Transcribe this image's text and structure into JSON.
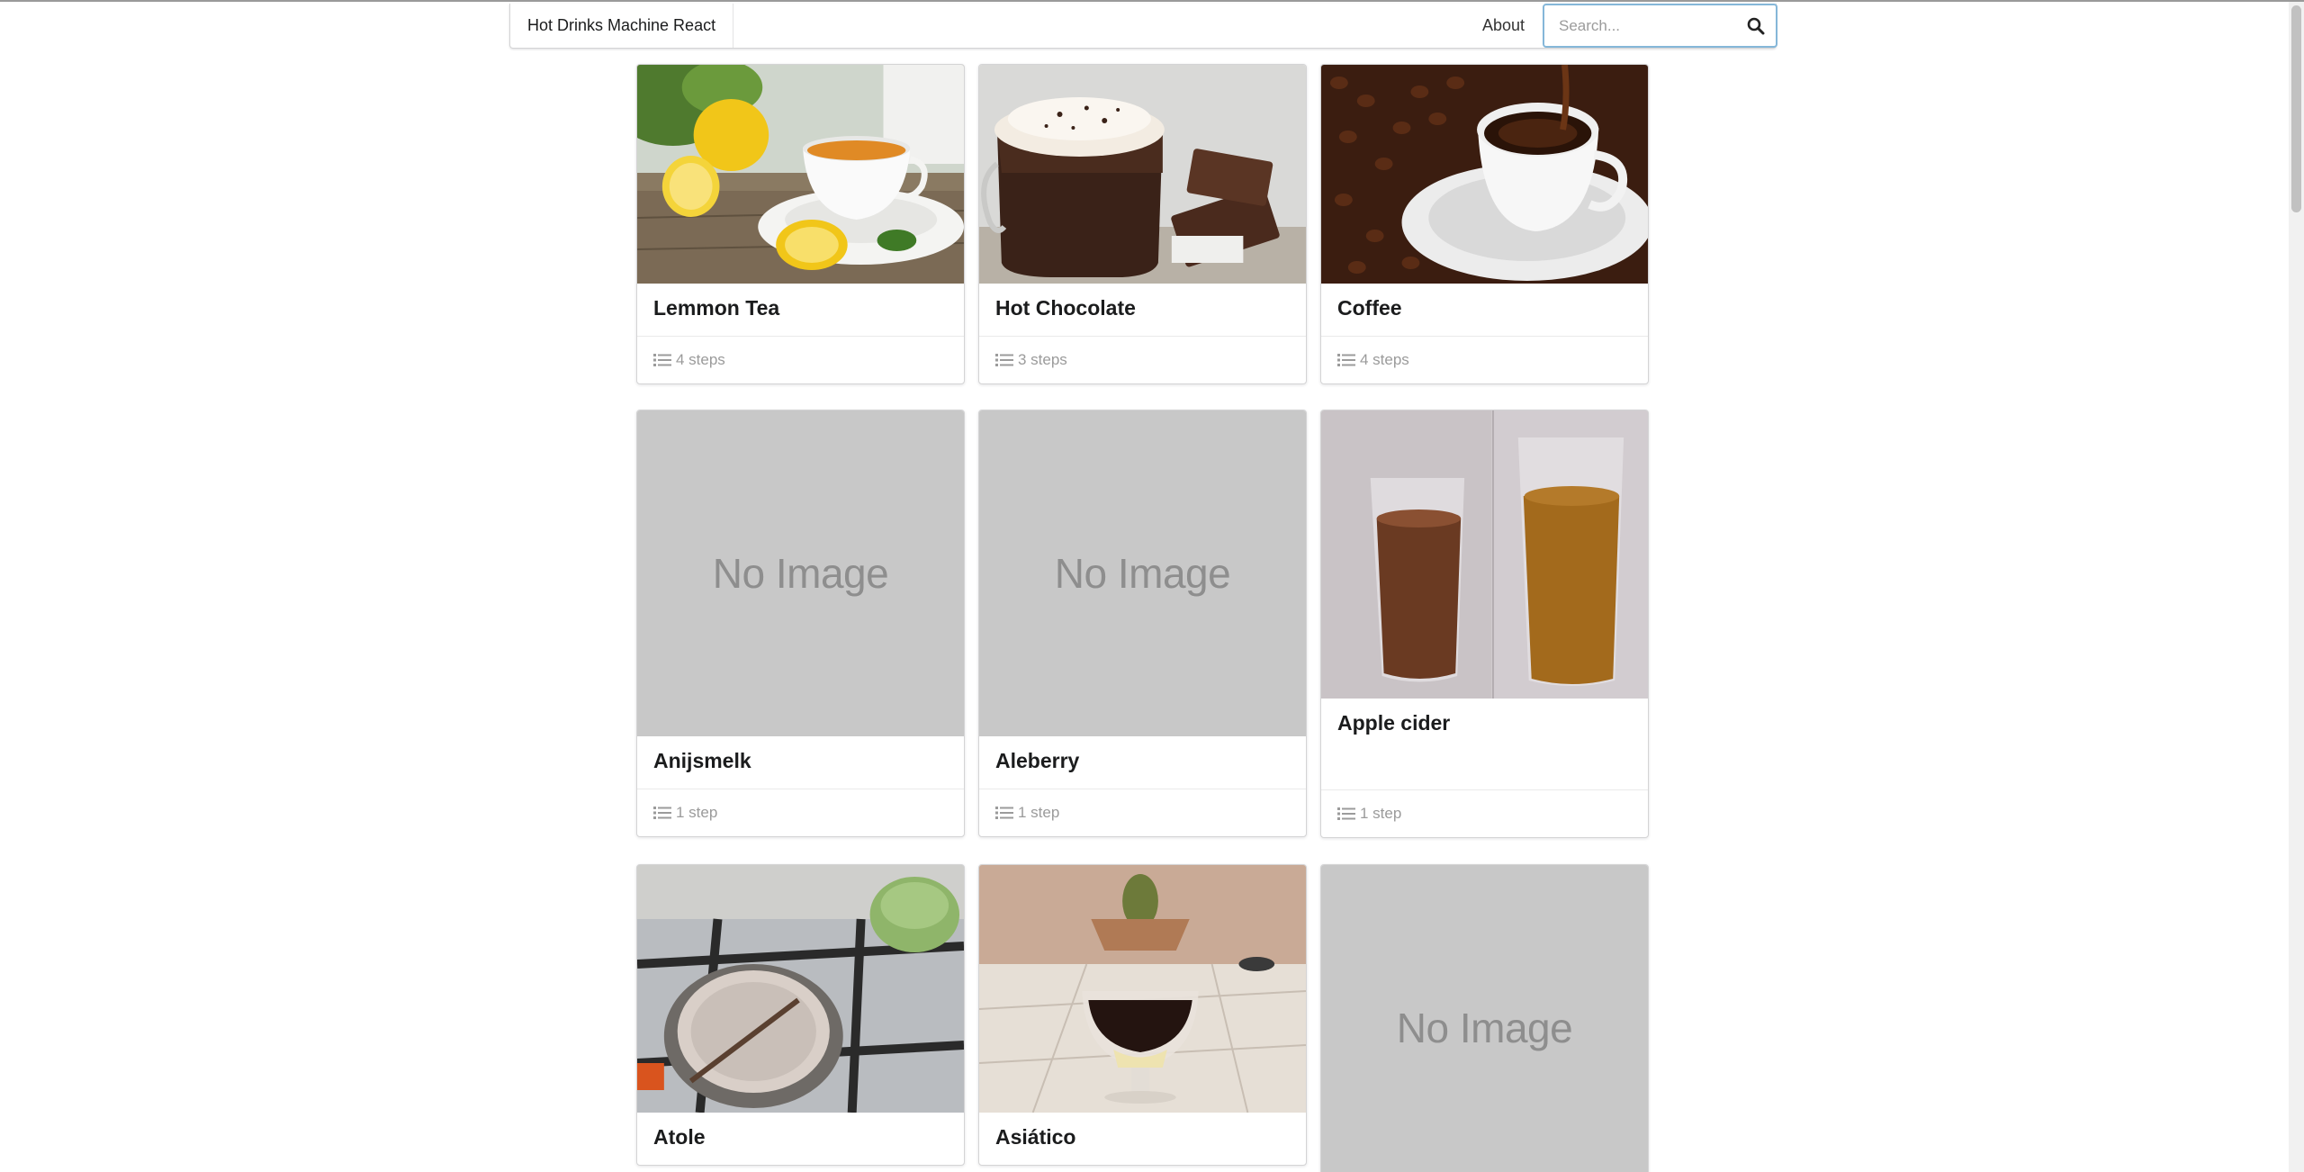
{
  "nav": {
    "brand": "Hot Drinks Machine React",
    "about": "About",
    "search_placeholder": "Search..."
  },
  "icons": {
    "search": "search-icon",
    "steps": "list-icon"
  },
  "cards": [
    {
      "title": "Lemmon Tea",
      "steps": "4 steps",
      "image": "photo"
    },
    {
      "title": "Hot Chocolate",
      "steps": "3 steps",
      "image": "photo"
    },
    {
      "title": "Coffee",
      "steps": "4 steps",
      "image": "photo"
    },
    {
      "title": "Anijsmelk",
      "steps": "1 step",
      "image": "No Image"
    },
    {
      "title": "Aleberry",
      "steps": "1 step",
      "image": "No Image"
    },
    {
      "title": "Apple cider",
      "steps": "1 step",
      "image": "photo"
    },
    {
      "title": "Atole",
      "steps": "",
      "image": "photo"
    },
    {
      "title": "Asiático",
      "steps": "",
      "image": "photo"
    },
    {
      "title": "",
      "steps": "",
      "image": "No Image"
    }
  ],
  "no_image_label": "No Image",
  "colors": {
    "focus_border": "#85b7d9",
    "placeholder_bg": "#c8c8c8",
    "meta_text": "#9b9b9b"
  }
}
